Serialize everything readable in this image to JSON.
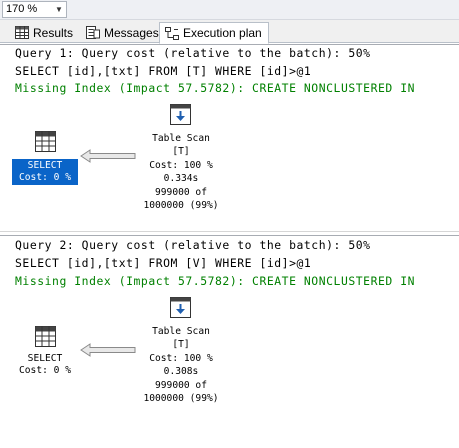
{
  "toolbar": {
    "zoom_value": "170 %"
  },
  "tabs": [
    {
      "label": "Results"
    },
    {
      "label": "Messages"
    },
    {
      "label": "Execution plan"
    }
  ],
  "queries": [
    {
      "header": "Query 1: Query cost (relative to the batch): 50%",
      "sql": "SELECT [id],[txt] FROM [T] WHERE [id]>@1",
      "missing_index": "Missing Index (Impact 57.5782): CREATE NONCLUSTERED IN",
      "select_node": {
        "label": "SELECT",
        "cost": "Cost: 0 %"
      },
      "scan_node": {
        "title": "Table Scan",
        "object": "[T]",
        "cost": "Cost: 100 %",
        "time": "0.334s",
        "rows": "999000 of",
        "estimate": "1000000 (99%)"
      }
    },
    {
      "header": "Query 2: Query cost (relative to the batch): 50%",
      "sql": "SELECT [id],[txt] FROM [V] WHERE [id]>@1",
      "missing_index": "Missing Index (Impact 57.5782): CREATE NONCLUSTERED IN",
      "select_node": {
        "label": "SELECT",
        "cost": "Cost: 0 %"
      },
      "scan_node": {
        "title": "Table Scan",
        "object": "[T]",
        "cost": "Cost: 100 %",
        "time": "0.308s",
        "rows": "999000 of",
        "estimate": "1000000 (99%)"
      }
    }
  ],
  "colors": {
    "missing_index_text": "#008000",
    "selection": "#0a64c8"
  }
}
